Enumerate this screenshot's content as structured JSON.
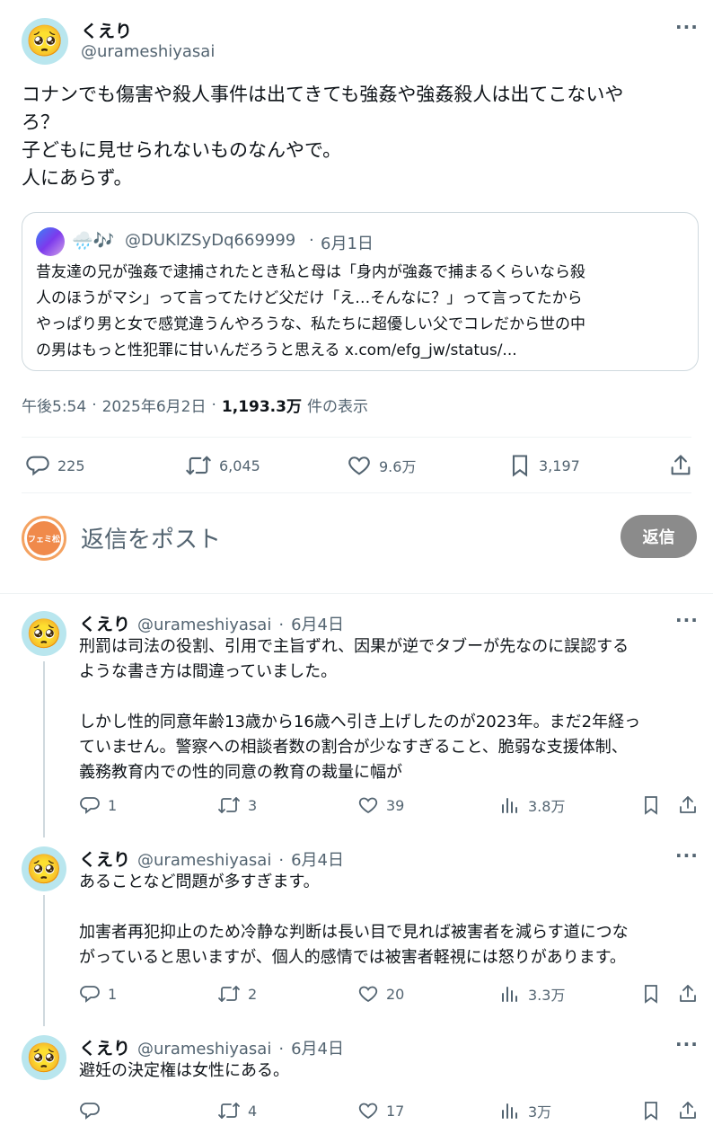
{
  "main_tweet": {
    "display_name": "くえり",
    "handle": "@urameshiyasai",
    "avatar_emoji": "🥺",
    "more": "···",
    "text_lines": [
      "コナンでも傷害や殺人事件は出てきても強姦や強姦殺人は出てこないや",
      "ろ？",
      "子どもに見せられないものなんやで。",
      "人にあらず。"
    ],
    "quote": {
      "emojis": "🌧️🎶",
      "handle": "@DUKlZSyDq669999",
      "sep": "·",
      "date": "6月1日",
      "text_lines": [
        "昔友達の兄が強姦で逮捕されたとき私と母は「身内が強姦で捕まるくらいなら殺",
        "人のほうがマシ」って言ってたけど父だけ「え…そんなに？」って言ってたから",
        "やっぱり男と女で感覚違うんやろうな、私たちに超優しい父でコレだから世の中",
        "の男はもっと性犯罪に甘いんだろうと思える x.com/efg_jw/status/..."
      ]
    },
    "meta": {
      "time": "午後5:54",
      "sep1": "·",
      "date": "2025年6月2日",
      "sep2": "·",
      "views": "1,193.3万",
      "views_label": "件の表示"
    },
    "actions": {
      "replies": "225",
      "retweets": "6,045",
      "likes": "9.6万",
      "bookmarks": "3,197"
    }
  },
  "reply_composer": {
    "avatar_text": "フェミ松",
    "placeholder": "返信をポスト",
    "button_label": "返信"
  },
  "replies": [
    {
      "display_name": "くえり",
      "handle": "@urameshiyasai",
      "sep": "·",
      "date": "6月4日",
      "text": "刑罰は司法の役割、引用で主旨ずれ、因果が逆でタブーが先なのに誤認する\nような書き方は間違っていました。\n\nしかし性的同意年齢13歳から16歳へ引き上げしたのが2023年。まだ2年経っ\nていません。警察への相談者数の割合が少なすぎること、脆弱な支援体制、\n義務教育内での性的同意の教育の裁量に幅が",
      "replies": "1",
      "retweets": "3",
      "likes": "39",
      "views": "3.8万"
    },
    {
      "display_name": "くえり",
      "handle": "@urameshiyasai",
      "sep": "·",
      "date": "6月4日",
      "text": "あることなど問題が多すぎます。\n\n加害者再犯抑止のため冷静な判断は長い目で見れば被害者を減らす道につな\nがっていると思いますが、個人的感情では被害者軽視には怒りがあります。",
      "replies": "1",
      "retweets": "2",
      "likes": "20",
      "views": "3.3万"
    },
    {
      "display_name": "くえり",
      "handle": "@urameshiyasai",
      "sep": "·",
      "date": "6月4日",
      "text": "避妊の決定権は女性にある。",
      "replies": "",
      "retweets": "4",
      "likes": "17",
      "views": "3万"
    }
  ]
}
